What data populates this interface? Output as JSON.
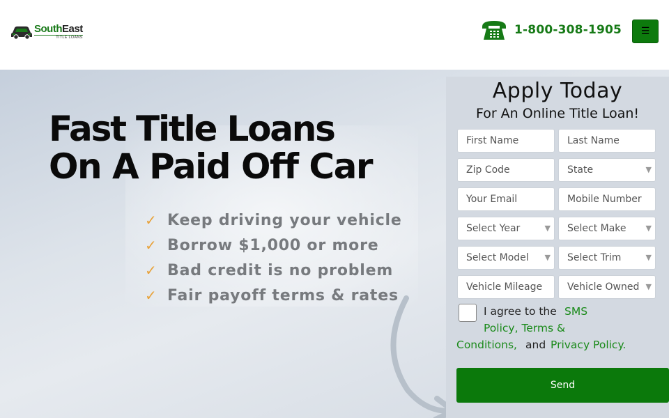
{
  "header": {
    "logo": {
      "main_green": "South",
      "main_dark": "East",
      "sub": "TITLE LOANS"
    },
    "phone": "1-800-308-1905",
    "menu_icon": "☰"
  },
  "hero": {
    "headline_line1": "Fast Title Loans",
    "headline_line2": "On A Paid Off Car",
    "benefits": [
      "Keep driving your vehicle",
      "Borrow $1,000 or more",
      "Bad credit is no problem",
      "Fair payoff terms & rates"
    ],
    "check_icon": "✓"
  },
  "form": {
    "title": "Apply Today",
    "subtitle": "For An Online Title Loan!",
    "fields": {
      "first_name": "First Name",
      "last_name": "Last Name",
      "zip": "Zip Code",
      "state": "State",
      "email": "Your Email",
      "mobile": "Mobile Number",
      "year": "Select Year",
      "make": "Select Make",
      "model": "Select Model",
      "trim": "Select Trim",
      "mileage": "Vehicle Mileage",
      "owned": "Vehicle Owned"
    },
    "agree": {
      "prefix": "I agree to the",
      "sms": "SMS",
      "policy_terms": "Policy, Terms &",
      "conditions": "Conditions,",
      "and": "and",
      "privacy": "Privacy Policy."
    },
    "send_label": "Send"
  },
  "colors": {
    "brand_green": "#0b790b",
    "check_orange": "#e8a23a",
    "panel_bg": "#d3d9e1"
  }
}
